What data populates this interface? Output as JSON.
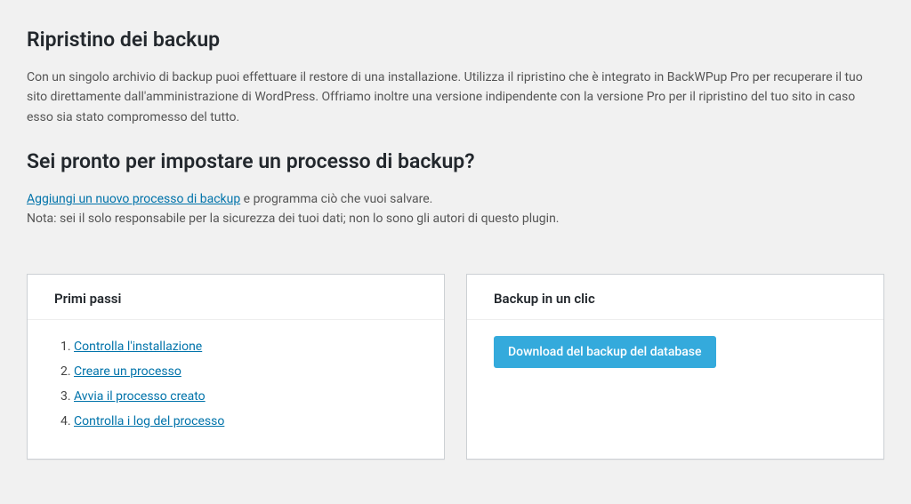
{
  "main": {
    "restore_heading": "Ripristino dei backup",
    "restore_description": "Con un singolo archivio di backup puoi effettuare il restore di una installazione. Utilizza il ripristino che è integrato in BackWPup Pro per recuperare il tuo sito direttamente dall'amministrazione di WordPress. Offriamo inoltre una versione indipendente con la versione Pro per il ripristino del tuo sito in caso esso sia stato compromesso del tutto.",
    "ready_heading": "Sei pronto per impostare un processo di backup?",
    "add_job_link": "Aggiungi un nuovo processo di backup",
    "add_job_suffix": " e programma ciò che vuoi salvare.",
    "note_text": "Nota: sei il solo responsabile per la sicurezza dei tuoi dati; non lo sono gli autori di questo plugin."
  },
  "first_steps": {
    "title": "Primi passi",
    "items": [
      {
        "label": "Controlla l'installazione"
      },
      {
        "label": "Creare un processo"
      },
      {
        "label": "Avvia il processo creato"
      },
      {
        "label": "Controlla i log del processo"
      }
    ]
  },
  "one_click": {
    "title": "Backup in un clic",
    "download_button": "Download del backup del database"
  }
}
